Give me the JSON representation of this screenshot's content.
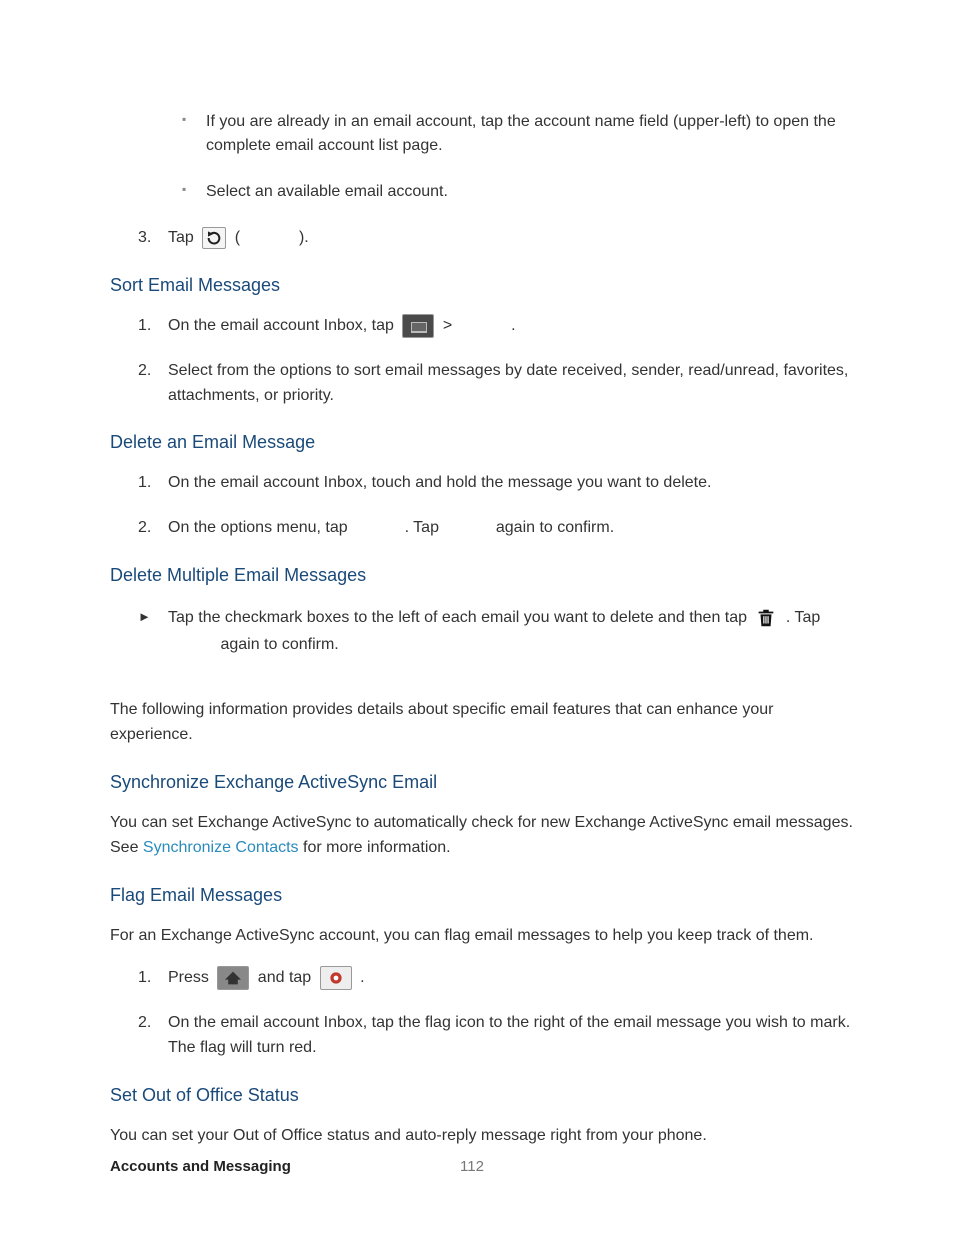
{
  "intro_bullets": [
    "If you are already in an email account, tap the account name field (upper-left) to open the complete email account list page.",
    "Select an available email account."
  ],
  "tap_step": {
    "prefix": "Tap",
    "suffix_open": " (",
    "suffix_close": ")."
  },
  "sort": {
    "heading": "Sort Email Messages",
    "step1_prefix": "On the email account Inbox, tap ",
    "step1_gt": " > ",
    "step1_suffix": ".",
    "step2": "Select from the options to sort email messages by date received, sender, read/unread, favorites, attachments, or priority."
  },
  "delete_one": {
    "heading": "Delete an Email Message",
    "step1": "On the email account Inbox, touch and hold the message you want to delete.",
    "step2_a": "On the options menu, tap ",
    "step2_b": ". Tap ",
    "step2_c": " again to confirm."
  },
  "delete_many": {
    "heading": "Delete Multiple Email Messages",
    "text_a": "Tap the checkmark boxes to the left of each email you want to delete and then tap ",
    "text_b": ". Tap ",
    "text_c": " again to confirm."
  },
  "activesync_intro": "The following information provides details about specific email features that can enhance your experience.",
  "sync": {
    "heading": "Synchronize Exchange ActiveSync Email",
    "para_a": "You can set Exchange ActiveSync to automatically check for new Exchange ActiveSync email messages. See ",
    "link": "Synchronize Contacts",
    "para_b": " for more information."
  },
  "flag": {
    "heading": "Flag Email Messages",
    "para": "For an Exchange ActiveSync account, you can flag email messages to help you keep track of them.",
    "step1_a": "Press ",
    "step1_b": " and tap ",
    "step1_c": ".",
    "step2": "On the email account Inbox, tap the flag icon to the right of the email message you wish to mark. The flag will turn red."
  },
  "ooo": {
    "heading": "Set Out of Office Status",
    "para": "You can set your Out of Office status and auto-reply message right from your phone."
  },
  "footer": {
    "section": "Accounts and Messaging",
    "page": "112"
  },
  "ordinals": {
    "n1": "1.",
    "n2": "2.",
    "n3": "3."
  }
}
